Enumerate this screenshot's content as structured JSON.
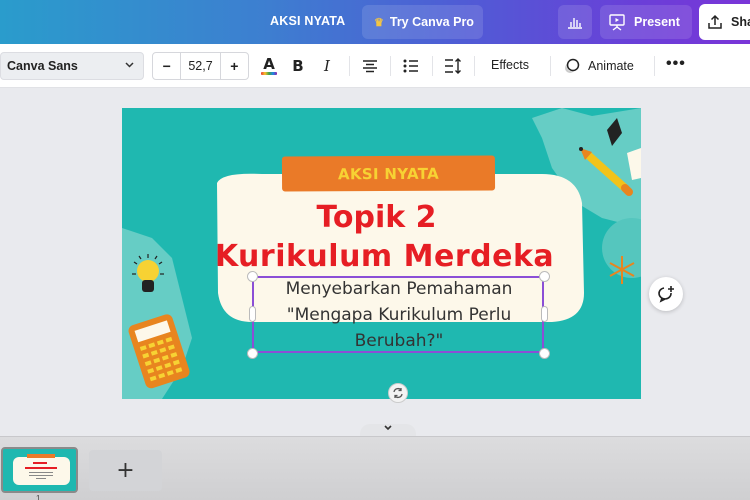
{
  "header": {
    "doc_title": "AKSI NYATA",
    "try_pro_label": "Try Canva Pro",
    "present_label": "Present",
    "share_label": "Share",
    "icons": {
      "crown": "crown-icon",
      "stats": "bar-chart-icon",
      "present": "presentation-icon",
      "share": "upload-icon"
    }
  },
  "toolbar": {
    "font_family": "Canva Sans",
    "font_size": "52,7",
    "decrease_label": "−",
    "increase_label": "+",
    "text_color_glyph": "A",
    "bold_glyph": "B",
    "italic_glyph": "I",
    "effects_label": "Effects",
    "animate_label": "Animate",
    "more_label": "•••"
  },
  "slide": {
    "tag": "AKSI NYATA",
    "title_line1": "Topik 2",
    "title_line2": "Kurikulum Merdeka",
    "subtitle_line1": "Menyebarkan Pemahaman",
    "subtitle_line2": "\"Mengapa Kurikulum Perlu",
    "subtitle_line3": "Berubah?\"",
    "colors": {
      "background": "#1fb8b0",
      "card": "#fdf8ea",
      "tag": "#ea7a28",
      "tag_text": "#f7d233",
      "title": "#e61e24"
    }
  },
  "pages": {
    "add_page_label": "+",
    "current_page": "1"
  }
}
